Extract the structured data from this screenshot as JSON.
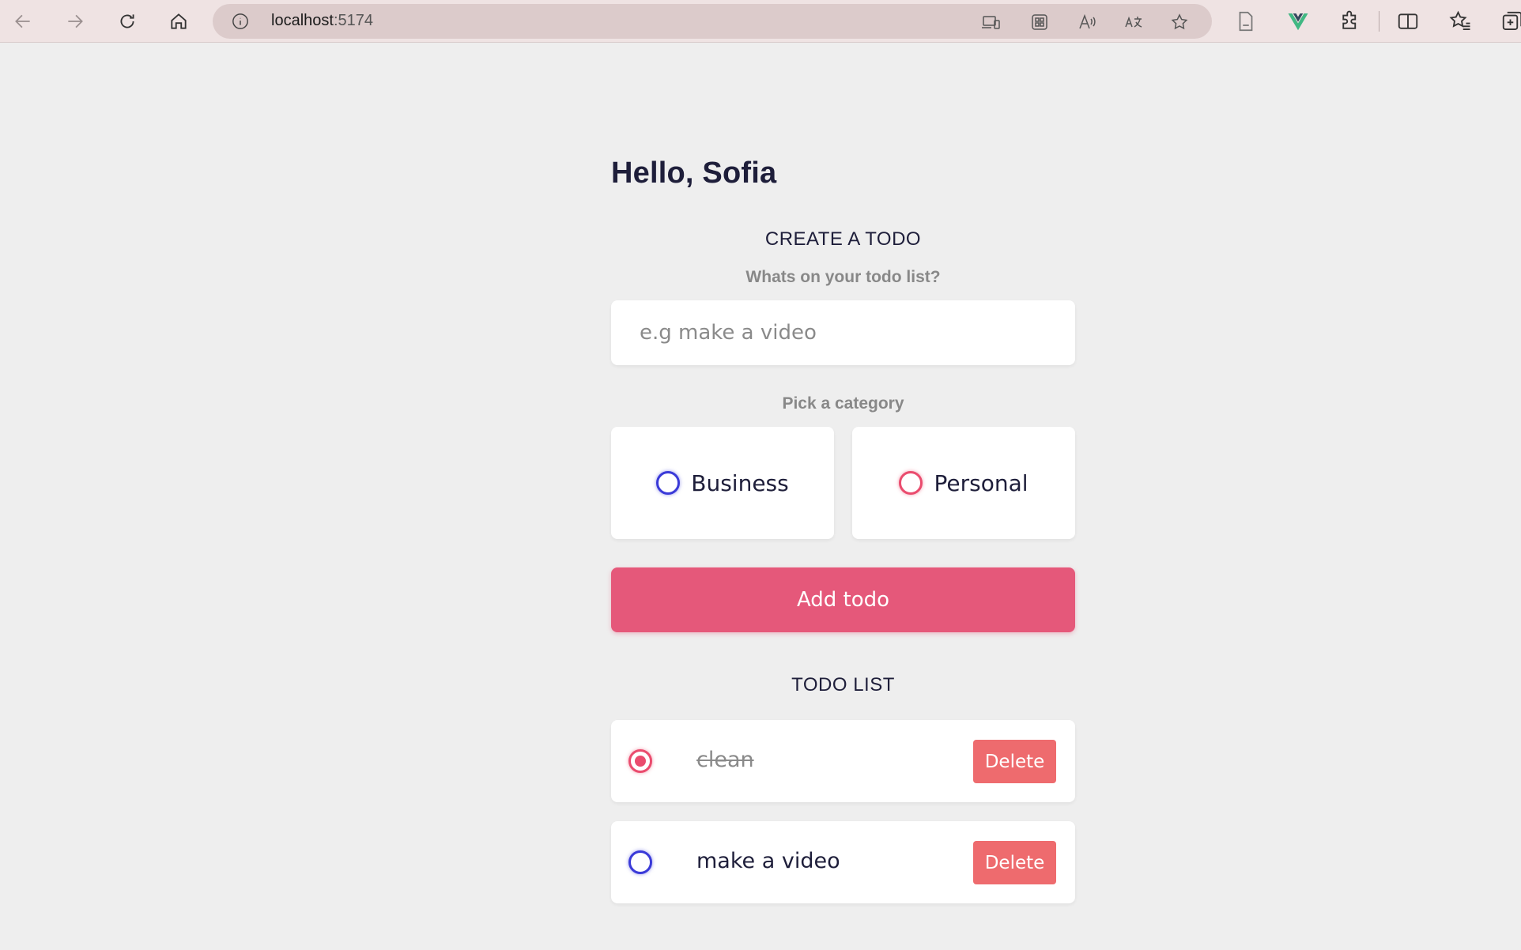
{
  "browser": {
    "url_host": "localhost",
    "url_port": ":5174"
  },
  "app": {
    "greeting": "Hello, Sofia",
    "create_title": "CREATE A TODO",
    "input_label": "Whats on your todo list?",
    "input_placeholder": "e.g make a video",
    "category_label": "Pick a category",
    "categories": [
      {
        "label": "Business",
        "color": "#3a3ad8",
        "selected": false
      },
      {
        "label": "Personal",
        "color": "#ea4c6e",
        "selected": false
      }
    ],
    "add_button": "Add todo",
    "list_title": "TODO LIST",
    "todos": [
      {
        "text": "clean",
        "done": true,
        "category": "Personal",
        "delete_label": "Delete"
      },
      {
        "text": "make a video",
        "done": false,
        "category": "Business",
        "delete_label": "Delete"
      }
    ]
  },
  "colors": {
    "accent": "#e5587a",
    "delete": "#ee6b6e",
    "business": "#3a3ad8",
    "personal": "#ea4c6e",
    "background": "#eeeeee"
  }
}
